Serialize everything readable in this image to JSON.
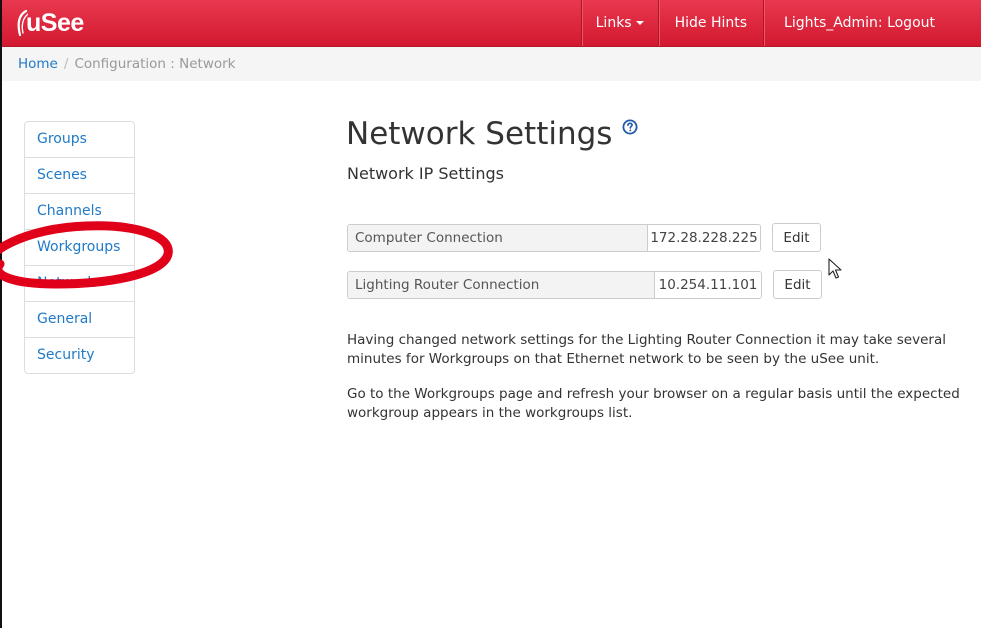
{
  "app": {
    "brand": "uSee",
    "colors": {
      "navbar": "#d91f35",
      "link": "#1f7ac8",
      "annotation": "#e0001a"
    }
  },
  "navbar": {
    "links_label": "Links",
    "hide_hints_label": "Hide Hints",
    "logout_label": "Lights_Admin: Logout"
  },
  "breadcrumb": {
    "home": "Home",
    "separator": "/",
    "current": "Configuration : Network"
  },
  "sidebar": {
    "items": [
      {
        "label": "Groups"
      },
      {
        "label": "Scenes"
      },
      {
        "label": "Channels"
      },
      {
        "label": "Workgroups"
      },
      {
        "label": "Network"
      },
      {
        "label": "General"
      },
      {
        "label": "Security"
      }
    ],
    "highlighted_item": "Workgroups"
  },
  "main": {
    "title": "Network Settings",
    "subtitle": "Network IP Settings",
    "connections": [
      {
        "label": "Computer Connection",
        "value": "172.28.228.225",
        "button": "Edit"
      },
      {
        "label": "Lighting Router Connection",
        "value": "10.254.11.101",
        "button": "Edit"
      }
    ],
    "info_paragraphs": [
      "Having changed network settings for the Lighting Router Connection it may take several minutes for Workgroups on that Ethernet network to be seen by the uSee unit.",
      "Go to the Workgroups page and refresh your browser on a regular basis until the expected workgroup appears in the workgroups list."
    ]
  },
  "icons": {
    "help": "question-circle-icon",
    "caret": "caret-down-icon",
    "cursor": "mouse-pointer-icon",
    "brand_mark": "brand-swoosh-icon"
  }
}
